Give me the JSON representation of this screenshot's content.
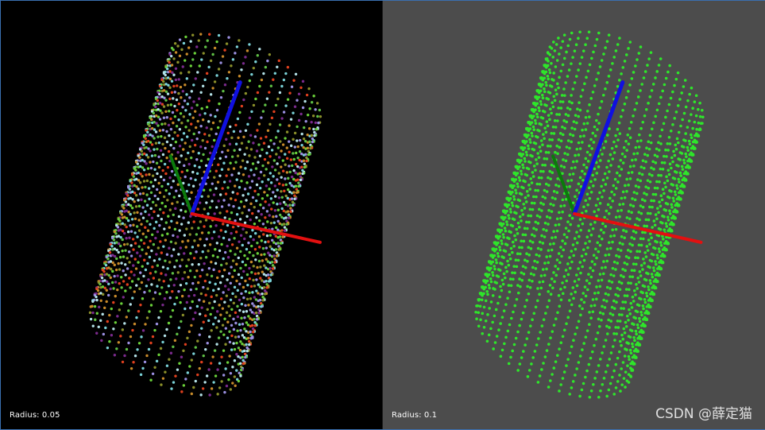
{
  "viewports": {
    "left": {
      "background": "#000000",
      "label": "Radius: 0.05",
      "cloud_colors": [
        "#7ad1d6",
        "#9a8fe0",
        "#7a2a8c",
        "#8a8f2a",
        "#6ad03a",
        "#e0401e",
        "#c78a2a",
        "#5fbf45",
        "#b3e0e6"
      ]
    },
    "right": {
      "background": "#4c4c4c",
      "label": "Radius: 0.1",
      "cloud_colors": [
        "#2ee62a"
      ]
    }
  },
  "axes": {
    "x_color": "#e31010",
    "y_color": "#0b7a0b",
    "z_color": "#1010e0"
  },
  "watermark": "CSDN @薛定猫"
}
